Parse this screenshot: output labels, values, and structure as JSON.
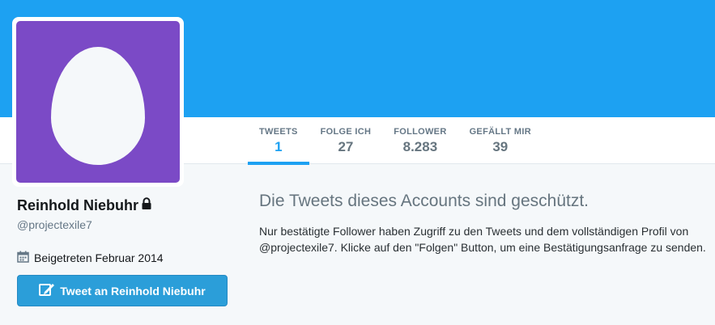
{
  "profile": {
    "name": "Reinhold Niebuhr",
    "handle": "@projectexile7",
    "joined": "Beigetreten Februar 2014",
    "tweet_button": "Tweet an Reinhold Niebuhr"
  },
  "stats": [
    {
      "label": "TWEETS",
      "value": "1",
      "active": true
    },
    {
      "label": "FOLGE ICH",
      "value": "27"
    },
    {
      "label": "FOLLOWER",
      "value": "8.283"
    },
    {
      "label": "GEFÄLLT MIR",
      "value": "39"
    }
  ],
  "protected": {
    "title": "Die Tweets dieses Accounts sind geschützt.",
    "description": "Nur bestätigte Follower haben Zugriff zu den Tweets und dem vollständigen Profil von @projectexile7. Klicke auf den \"Folgen\" Button, um eine Bestätigungsanfrage zu senden."
  },
  "colors": {
    "banner": "#1da1f2",
    "avatar_background": "#7b4ac6",
    "button": "#2b9ed9"
  },
  "icons": [
    "lock-icon",
    "calendar-icon",
    "tweet-compose-icon",
    "default-egg-avatar"
  ]
}
